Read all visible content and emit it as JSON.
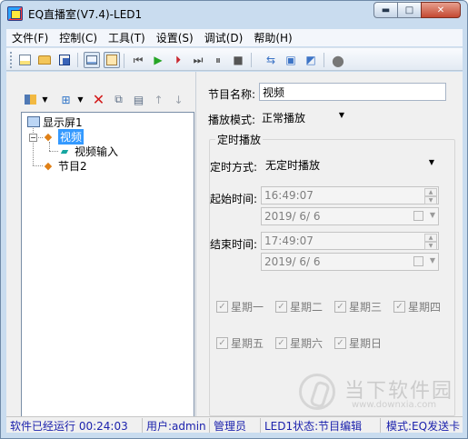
{
  "window": {
    "title": "EQ直播室(V7.4)-LED1",
    "controls": [
      "minimize",
      "maximize",
      "close"
    ]
  },
  "menu": [
    "文件(F)",
    "控制(C)",
    "工具(T)",
    "设置(S)",
    "调试(D)",
    "帮助(H)"
  ],
  "toolbar": {
    "icons": [
      "new-icon",
      "open-folder-icon",
      "save-icon",
      "display-mode-icon",
      "edit-program-icon",
      "skip-start-icon",
      "play-icon",
      "play-step-icon",
      "step-end-icon",
      "pause-icon",
      "stop-icon",
      "send-icon",
      "screen-settings-icon",
      "screen-test-icon",
      "record-icon"
    ]
  },
  "left_toolbar": {
    "icons": [
      "layout-icon",
      "add-program-icon",
      "delete-icon",
      "copy-icon",
      "paste-icon",
      "move-up-icon",
      "move-down-icon"
    ]
  },
  "tree": {
    "nodes": [
      {
        "label": "显示屏1",
        "icon": "screen-icon",
        "level": 0,
        "selected": false
      },
      {
        "label": "视频",
        "icon": "program-icon",
        "level": 1,
        "selected": true
      },
      {
        "label": "视频输入",
        "icon": "video-input-icon",
        "level": 2,
        "selected": false
      },
      {
        "label": "节目2",
        "icon": "program-icon",
        "level": 1,
        "selected": false
      }
    ]
  },
  "properties": {
    "program_name_label": "节目名称:",
    "program_name": "视频",
    "play_mode_label": "播放模式:",
    "play_mode": "正常播放",
    "timed_play_title": "定时播放",
    "timing_method_label": "定时方式:",
    "timing_method": "无定时播放",
    "start_label": "起始时间:",
    "start_time": "16:49:07",
    "start_date": "2019/  6/  6",
    "end_label": "结束时间:",
    "end_time": "17:49:07",
    "end_date": "2019/  6/  6",
    "weekdays": [
      "星期一",
      "星期二",
      "星期三",
      "星期四",
      "星期五",
      "星期六",
      "星期日"
    ]
  },
  "watermark": {
    "text": "当下软件园",
    "url": "www.downxia.com"
  },
  "status": {
    "runtime": "软件已经运行 00:24:03",
    "user": "用户:admin",
    "role": "管理员",
    "led_state": "LED1状态:节目编辑",
    "mode": "模式:EQ发送卡"
  }
}
